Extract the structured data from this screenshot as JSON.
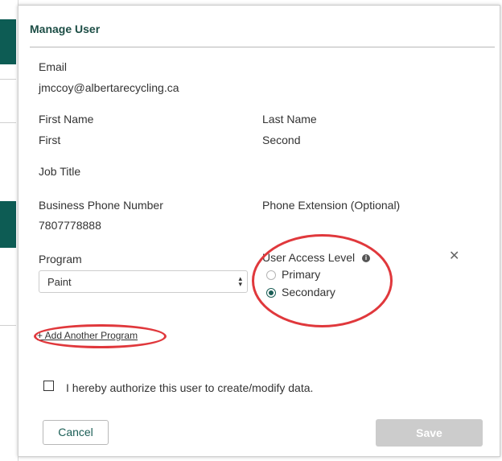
{
  "modal": {
    "title": "Manage User"
  },
  "email": {
    "label": "Email",
    "value": "jmccoy@albertarecycling.ca"
  },
  "first_name": {
    "label": "First Name",
    "value": "First"
  },
  "last_name": {
    "label": "Last Name",
    "value": "Second"
  },
  "job_title": {
    "label": "Job Title",
    "value": ""
  },
  "business_phone": {
    "label": "Business Phone Number",
    "value": "7807778888"
  },
  "phone_extension": {
    "label": "Phone Extension (Optional)",
    "value": ""
  },
  "program": {
    "label": "Program",
    "selected": "Paint"
  },
  "access_level": {
    "label": "User Access Level",
    "options": [
      {
        "label": "Primary",
        "checked": false
      },
      {
        "label": "Secondary",
        "checked": true
      }
    ]
  },
  "add_program_link": "+ Add Another Program",
  "authorize_checkbox": {
    "label": "I hereby authorize this user to create/modify data.",
    "checked": false
  },
  "buttons": {
    "cancel": "Cancel",
    "save": "Save"
  },
  "colors": {
    "brand": "#1b5e56",
    "header_text": "#1c4d45",
    "save_disabled": "#cccccc",
    "annotation": "#e0383c"
  },
  "icons": {
    "info": "info-icon",
    "close": "close-icon",
    "select_arrow": "updown-arrow-icon"
  }
}
